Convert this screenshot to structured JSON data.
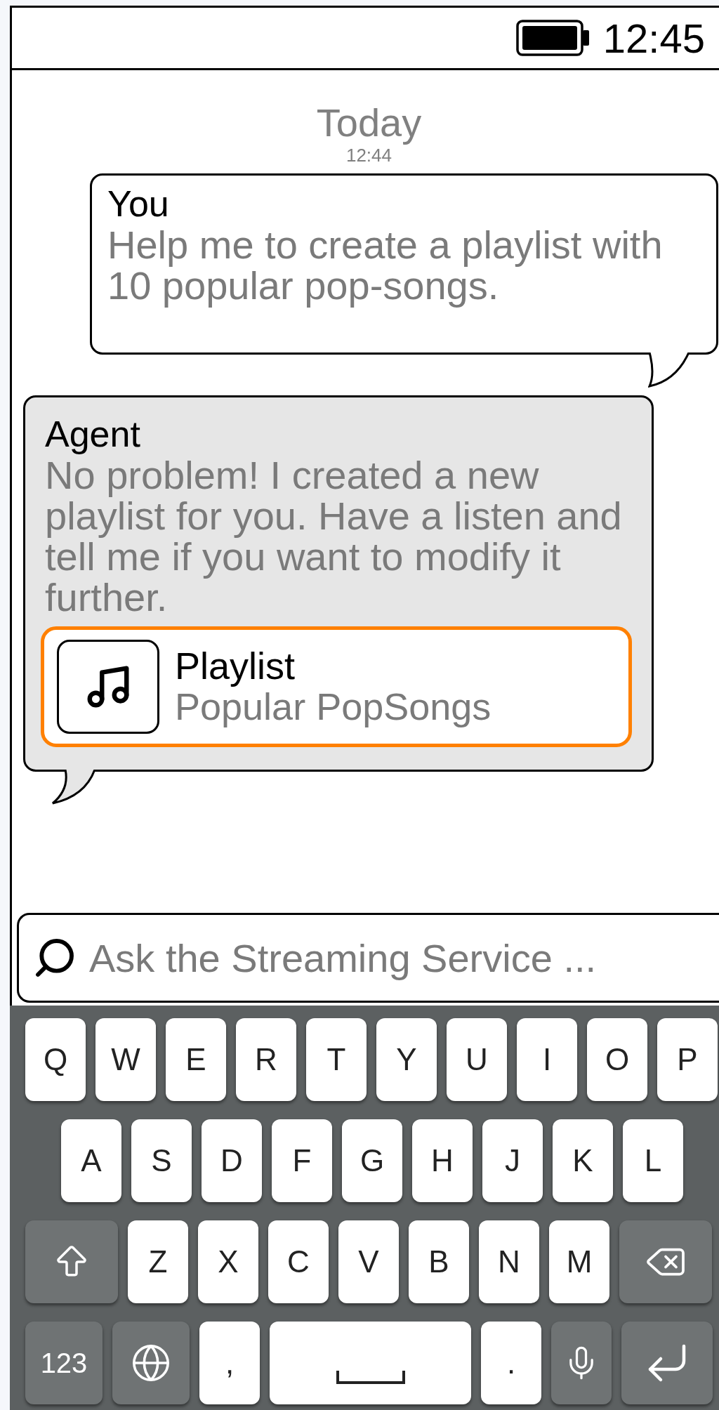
{
  "status_bar": {
    "time": "12:45"
  },
  "chat": {
    "day": "Today",
    "time": "12:44",
    "messages": [
      {
        "kind": "user",
        "sender": "You",
        "text": "Help me to create a playlist with 10 popular pop-songs."
      },
      {
        "kind": "agent",
        "sender": "Agent",
        "text": "No problem! I created a new playlist for you. Have a listen and tell me if you want to modify it further.",
        "attachment": {
          "title": "Playlist",
          "subtitle": "Popular PopSongs"
        }
      }
    ]
  },
  "search": {
    "placeholder": "Ask the Streaming Service ..."
  },
  "keyboard": {
    "rows": [
      {
        "keys": [
          {
            "kind": "letter",
            "label": "Q"
          },
          {
            "kind": "letter",
            "label": "W"
          },
          {
            "kind": "letter",
            "label": "E"
          },
          {
            "kind": "letter",
            "label": "R"
          },
          {
            "kind": "letter",
            "label": "T"
          },
          {
            "kind": "letter",
            "label": "Y"
          },
          {
            "kind": "letter",
            "label": "U"
          },
          {
            "kind": "letter",
            "label": "I"
          },
          {
            "kind": "letter",
            "label": "O"
          },
          {
            "kind": "letter",
            "label": "P"
          }
        ]
      },
      {
        "keys": [
          {
            "kind": "letter",
            "label": "A"
          },
          {
            "kind": "letter",
            "label": "S"
          },
          {
            "kind": "letter",
            "label": "D"
          },
          {
            "kind": "letter",
            "label": "F"
          },
          {
            "kind": "letter",
            "label": "G"
          },
          {
            "kind": "letter",
            "label": "H"
          },
          {
            "kind": "letter",
            "label": "J"
          },
          {
            "kind": "letter",
            "label": "K"
          },
          {
            "kind": "letter",
            "label": "L"
          }
        ]
      },
      {
        "keys": [
          {
            "kind": "shift"
          },
          {
            "kind": "letter",
            "label": "Z"
          },
          {
            "kind": "letter",
            "label": "X"
          },
          {
            "kind": "letter",
            "label": "C"
          },
          {
            "kind": "letter",
            "label": "V"
          },
          {
            "kind": "letter",
            "label": "B"
          },
          {
            "kind": "letter",
            "label": "N"
          },
          {
            "kind": "letter",
            "label": "M"
          },
          {
            "kind": "backspace"
          }
        ]
      },
      {
        "keys": [
          {
            "kind": "numbers",
            "label": "123"
          },
          {
            "kind": "globe"
          },
          {
            "kind": "punct",
            "label": ","
          },
          {
            "kind": "space"
          },
          {
            "kind": "punct",
            "label": "."
          },
          {
            "kind": "mic"
          },
          {
            "kind": "return"
          }
        ]
      }
    ]
  }
}
